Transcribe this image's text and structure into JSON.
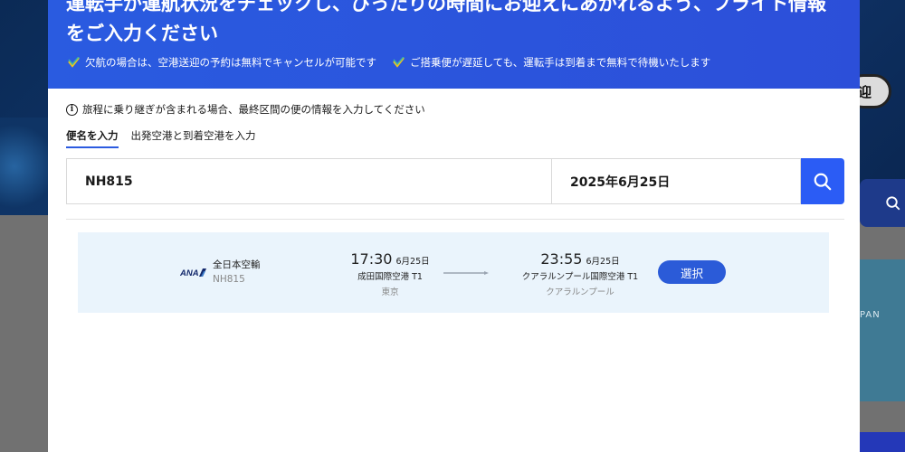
{
  "background": {
    "right_pill_label": "迎",
    "map_text": "PAN"
  },
  "modal": {
    "title": "運転手が運航状況をチェックし、ぴったりの時間にお迎えにあがれるよう、フライト情報をご入力ください",
    "benefits": [
      "欠航の場合は、空港送迎の予約は無料でキャンセルが可能です",
      "ご搭乗便が遅延しても、運転手は到着まで無料で待機いたします"
    ],
    "info": "旅程に乗り継ぎが含まれる場合、最終区間の便の情報を入力してください",
    "tabs": [
      {
        "label": "便名を入力",
        "active": true
      },
      {
        "label": "出発空港と到着空港を入力",
        "active": false
      }
    ],
    "search": {
      "flight_value": "NH815",
      "date_value": "2025年6月25日"
    },
    "result": {
      "airline_name": "全日本空輸",
      "airline_logo_text": "ANA",
      "flight_code": "NH815",
      "departure": {
        "time": "17:30",
        "date": "6月25日",
        "airport": "成田国際空港 T1",
        "city": "東京"
      },
      "arrival": {
        "time": "23:55",
        "date": "6月25日",
        "airport": "クアラルンプール国際空港 T1",
        "city": "クアラルンプール"
      },
      "select_label": "選択"
    }
  },
  "colors": {
    "header_blue": "#2a5be0",
    "search_button": "#2b5cf5",
    "select_button": "#2b5bd8",
    "result_bg": "#eaf4fc",
    "check_teal": "#3fb6a8",
    "check_yellow": "#f5c518"
  },
  "icons": {
    "check": "check-icon",
    "info": "info-icon",
    "search": "search-icon",
    "arrow": "arrow-right-icon"
  }
}
